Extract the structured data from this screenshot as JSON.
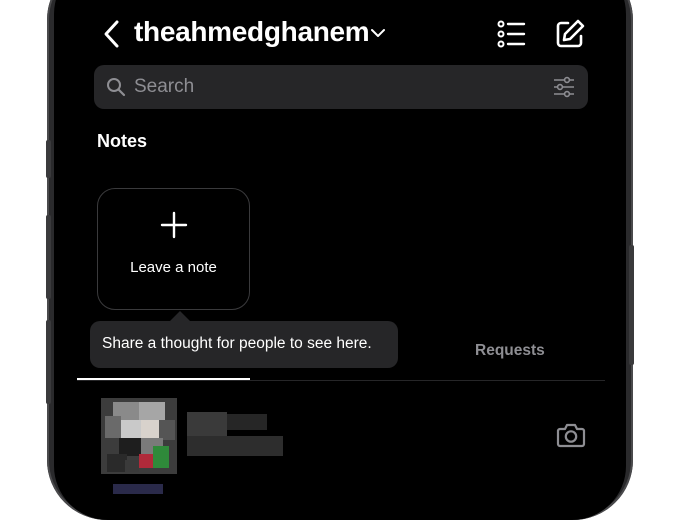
{
  "header": {
    "username": "theahmedghanem",
    "back_icon": "chevron-left-icon",
    "dropdown_icon": "chevron-down-icon",
    "list_icon": "list-icon",
    "compose_icon": "compose-icon"
  },
  "search": {
    "placeholder": "Search",
    "search_icon": "search-icon",
    "filter_icon": "filter-sliders-icon"
  },
  "notes": {
    "label": "Notes",
    "leave_note": "Leave a note",
    "tooltip": "Share a thought for people to see here."
  },
  "tabs": {
    "requests": "Requests"
  },
  "conversation": {
    "camera_icon": "camera-icon"
  },
  "colors": {
    "background": "#000000",
    "surface": "#262628",
    "text": "#ffffff",
    "muted": "#8e8e93"
  }
}
